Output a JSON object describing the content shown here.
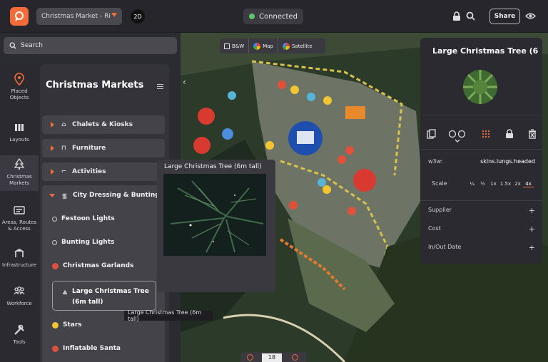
{
  "header": {
    "project_name": "Christmas Market - Ri",
    "view_mode": "2D",
    "connection_status": "Connected",
    "share_label": "Share",
    "accent_color": "#f26b3a",
    "status_color": "#58c76a"
  },
  "search": {
    "placeholder": "Search"
  },
  "nav": [
    {
      "label_line1": "Placed",
      "label_line2": "Objects",
      "icon": "map-pin-icon"
    },
    {
      "label_line1": "Layouts",
      "label_line2": "",
      "icon": "layouts-icon"
    },
    {
      "label_line1": "Christmas",
      "label_line2": "Markets",
      "icon": "christmas-tree-icon"
    },
    {
      "label_line1": "Areas, Routes",
      "label_line2": "& Access",
      "icon": "areas-icon"
    },
    {
      "label_line1": "Infrastructure",
      "label_line2": "",
      "icon": "infrastructure-icon"
    },
    {
      "label_line1": "Workforce",
      "label_line2": "",
      "icon": "workforce-icon"
    },
    {
      "label_line1": "Tools",
      "label_line2": "",
      "icon": "tools-icon"
    }
  ],
  "panel": {
    "title": "Christmas Markets",
    "categories": [
      {
        "label": "Chalets & Kiosks",
        "icon": "chalet-icon"
      },
      {
        "label": "Furniture",
        "icon": "furniture-icon"
      },
      {
        "label": "Activities",
        "icon": "activities-icon"
      }
    ],
    "expanded_category": {
      "label": "City Dressing & Bunting",
      "icon": "bunting-icon"
    },
    "items": [
      {
        "label": "Festoon Lights",
        "icon": "festoon-icon"
      },
      {
        "label": "Bunting Lights",
        "icon": "bunting-lights-icon"
      },
      {
        "label": "Christmas Garlands",
        "icon": "garland-icon"
      },
      {
        "label_line1": "Large Christmas Tree",
        "label_line2": "(6m tall)",
        "icon": "tree-icon"
      },
      {
        "label": "Stars",
        "icon": "star-icon"
      },
      {
        "label": "Inflatable Santa",
        "icon": "santa-icon"
      }
    ]
  },
  "map": {
    "layers": [
      "B&W",
      "Map",
      "Satellite"
    ],
    "zoom": "18"
  },
  "preview": {
    "title": "Large Christmas Tree (6m tall)",
    "tooltip": "Large Christmas Tree (6m tall)"
  },
  "details": {
    "title": "Large Christmas Tree (6",
    "w3w_label": "w3w:",
    "w3w_value": "skins.lungs.headed",
    "scale_label": "Scale",
    "scale_options": [
      "¼",
      "½",
      "1x",
      "1.5x",
      "2x",
      "4x"
    ],
    "scale_selected": "4x",
    "rows": [
      "Supplier",
      "Cost",
      "In/Out Date"
    ]
  }
}
